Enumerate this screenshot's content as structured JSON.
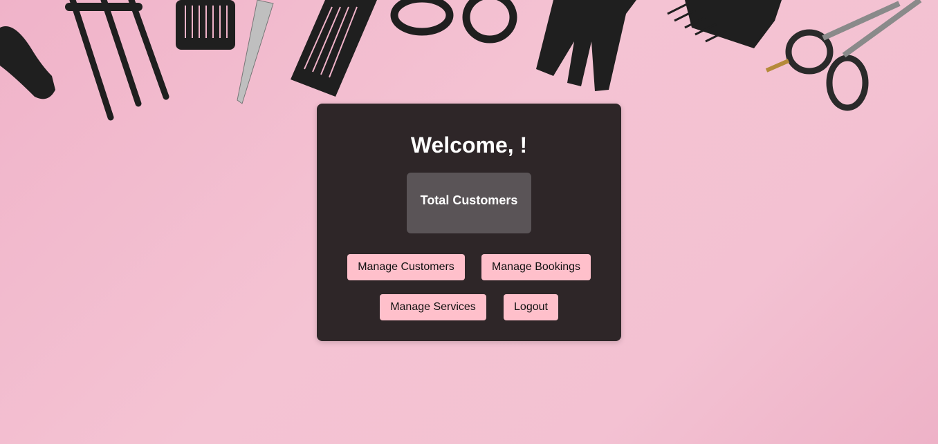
{
  "dashboard": {
    "welcome": "Welcome, !",
    "stats": {
      "total_customers_label": "Total Customers"
    },
    "actions": {
      "manage_customers": "Manage Customers",
      "manage_bookings": "Manage Bookings",
      "manage_services": "Manage Services",
      "logout": "Logout"
    }
  },
  "theme": {
    "background": "#f4c3d3",
    "card": "#2e2628",
    "stat_box": "#5a5457",
    "button": "#ffc0cb",
    "tools": "#1f1f1f"
  },
  "background_image": {
    "icons": [
      "hair-clip-icon",
      "pick-comb-icon",
      "comb-icon",
      "scissors-icon",
      "comb-icon",
      "scissors-icon",
      "wide-comb-icon",
      "clipper-icon",
      "scissors-icon"
    ]
  }
}
